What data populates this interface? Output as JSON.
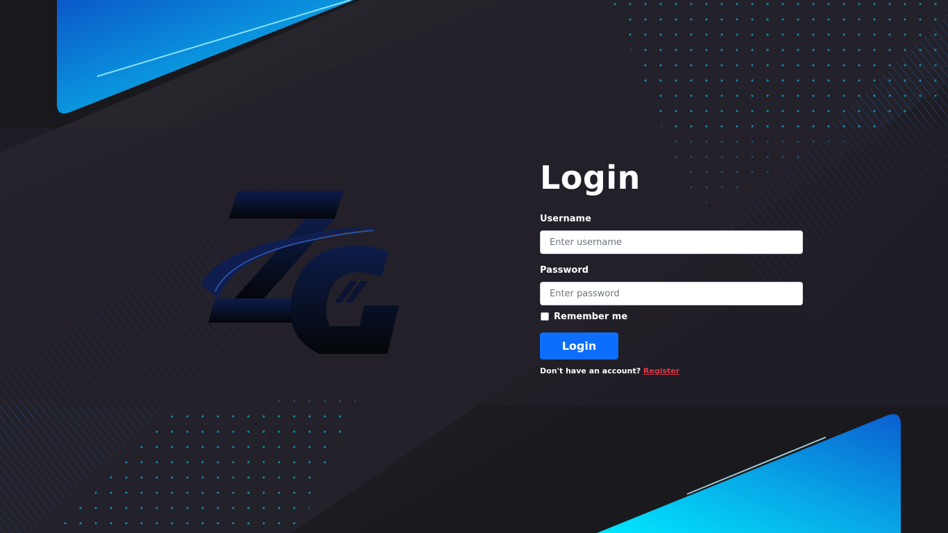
{
  "page": {
    "title": "Login"
  },
  "form": {
    "username": {
      "label": "Username",
      "placeholder": "Enter username",
      "value": ""
    },
    "password": {
      "label": "Password",
      "placeholder": "Enter password",
      "value": ""
    },
    "remember": {
      "label": "Remember me",
      "checked": false
    },
    "submit_label": "Login",
    "register_prompt": "Don't have an account?",
    "register_link": "Register"
  },
  "logo": {
    "text": "ZG",
    "icon": "zg-logo"
  },
  "colors": {
    "accent": "#0d6efd",
    "link": "#dc3545",
    "background": "#1c1b20",
    "highlight_cyan": "#00e5ff"
  }
}
